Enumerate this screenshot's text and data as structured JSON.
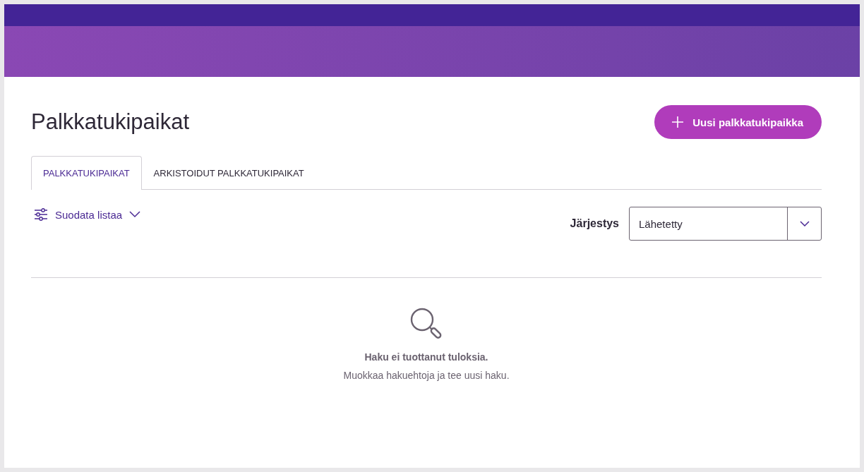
{
  "page": {
    "title": "Palkkatukipaikat"
  },
  "new_button": {
    "label": "Uusi palkkatukipaikka"
  },
  "tabs": [
    {
      "label": "PALKKATUKIPAIKAT",
      "selected": true
    },
    {
      "label": "ARKISTOIDUT PALKKATUKIPAIKAT",
      "selected": false
    }
  ],
  "filter": {
    "label": "Suodata listaa",
    "expanded": false
  },
  "sort": {
    "label": "Järjestys",
    "value": "Lähetetty"
  },
  "empty_state": {
    "title": "Haku ei tuottanut tuloksia.",
    "hint": "Muokkaa hakuehtoja ja tee uusi haku."
  }
}
